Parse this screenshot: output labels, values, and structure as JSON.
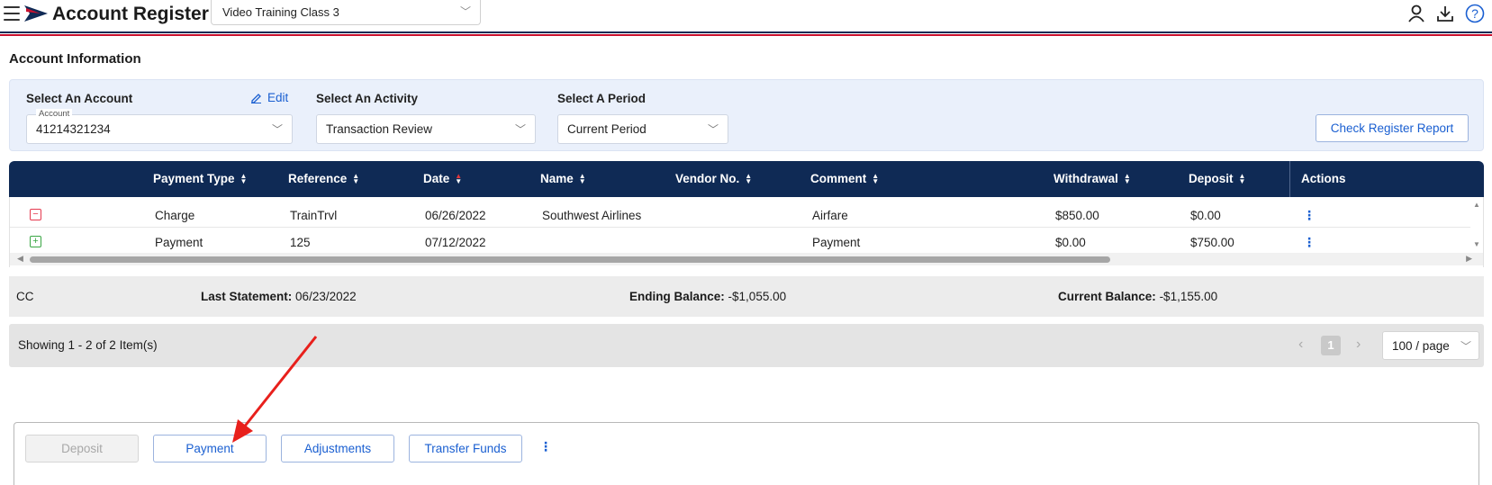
{
  "header": {
    "title": "Account Register",
    "class_selector": {
      "value": "Video Training Class 3"
    },
    "icons": [
      "user-icon",
      "download-icon",
      "help-icon"
    ]
  },
  "section": {
    "title": "Account Information"
  },
  "filters": {
    "account": {
      "label": "Select An Account",
      "edit_label": "Edit",
      "field_label": "Account",
      "value": "41214321234"
    },
    "activity": {
      "label": "Select An Activity",
      "value": "Transaction Review"
    },
    "period": {
      "label": "Select A Period",
      "value": "Current Period"
    },
    "report_button": "Check Register Report"
  },
  "table": {
    "columns": [
      "Payment Type",
      "Reference",
      "Date",
      "Name",
      "Vendor No.",
      "Comment",
      "Withdrawal",
      "Deposit",
      "Actions"
    ],
    "rows": [
      {
        "expander": "−",
        "payment_type": "Charge",
        "reference": "TrainTrvl",
        "date": "06/26/2022",
        "name": "Southwest Airlines",
        "vendor_no": "",
        "comment": "Airfare",
        "withdrawal": "$850.00",
        "deposit": "$0.00"
      },
      {
        "expander": "+",
        "payment_type": "Payment",
        "reference": "125",
        "date": "07/12/2022",
        "name": "",
        "vendor_no": "",
        "comment": "Payment",
        "withdrawal": "$0.00",
        "deposit": "$750.00"
      }
    ]
  },
  "summary": {
    "account_type": "CC",
    "last_statement_label": "Last Statement",
    "last_statement_value": "06/23/2022",
    "ending_balance_label": "Ending Balance",
    "ending_balance_value": "-$1,055.00",
    "current_balance_label": "Current Balance",
    "current_balance_value": "-$1,155.00"
  },
  "pagination": {
    "info": "Showing 1 - 2 of 2 Item(s)",
    "current_page": "1",
    "page_size": "100 / page"
  },
  "actions": {
    "deposit": "Deposit",
    "payment": "Payment",
    "adjustments": "Adjustments",
    "transfer_funds": "Transfer Funds"
  },
  "colors": {
    "header_navy": "#0f2a55",
    "accent_blue": "#1a5fd1",
    "brand_red": "#c8102e",
    "annotation_arrow": "#e8201c"
  }
}
